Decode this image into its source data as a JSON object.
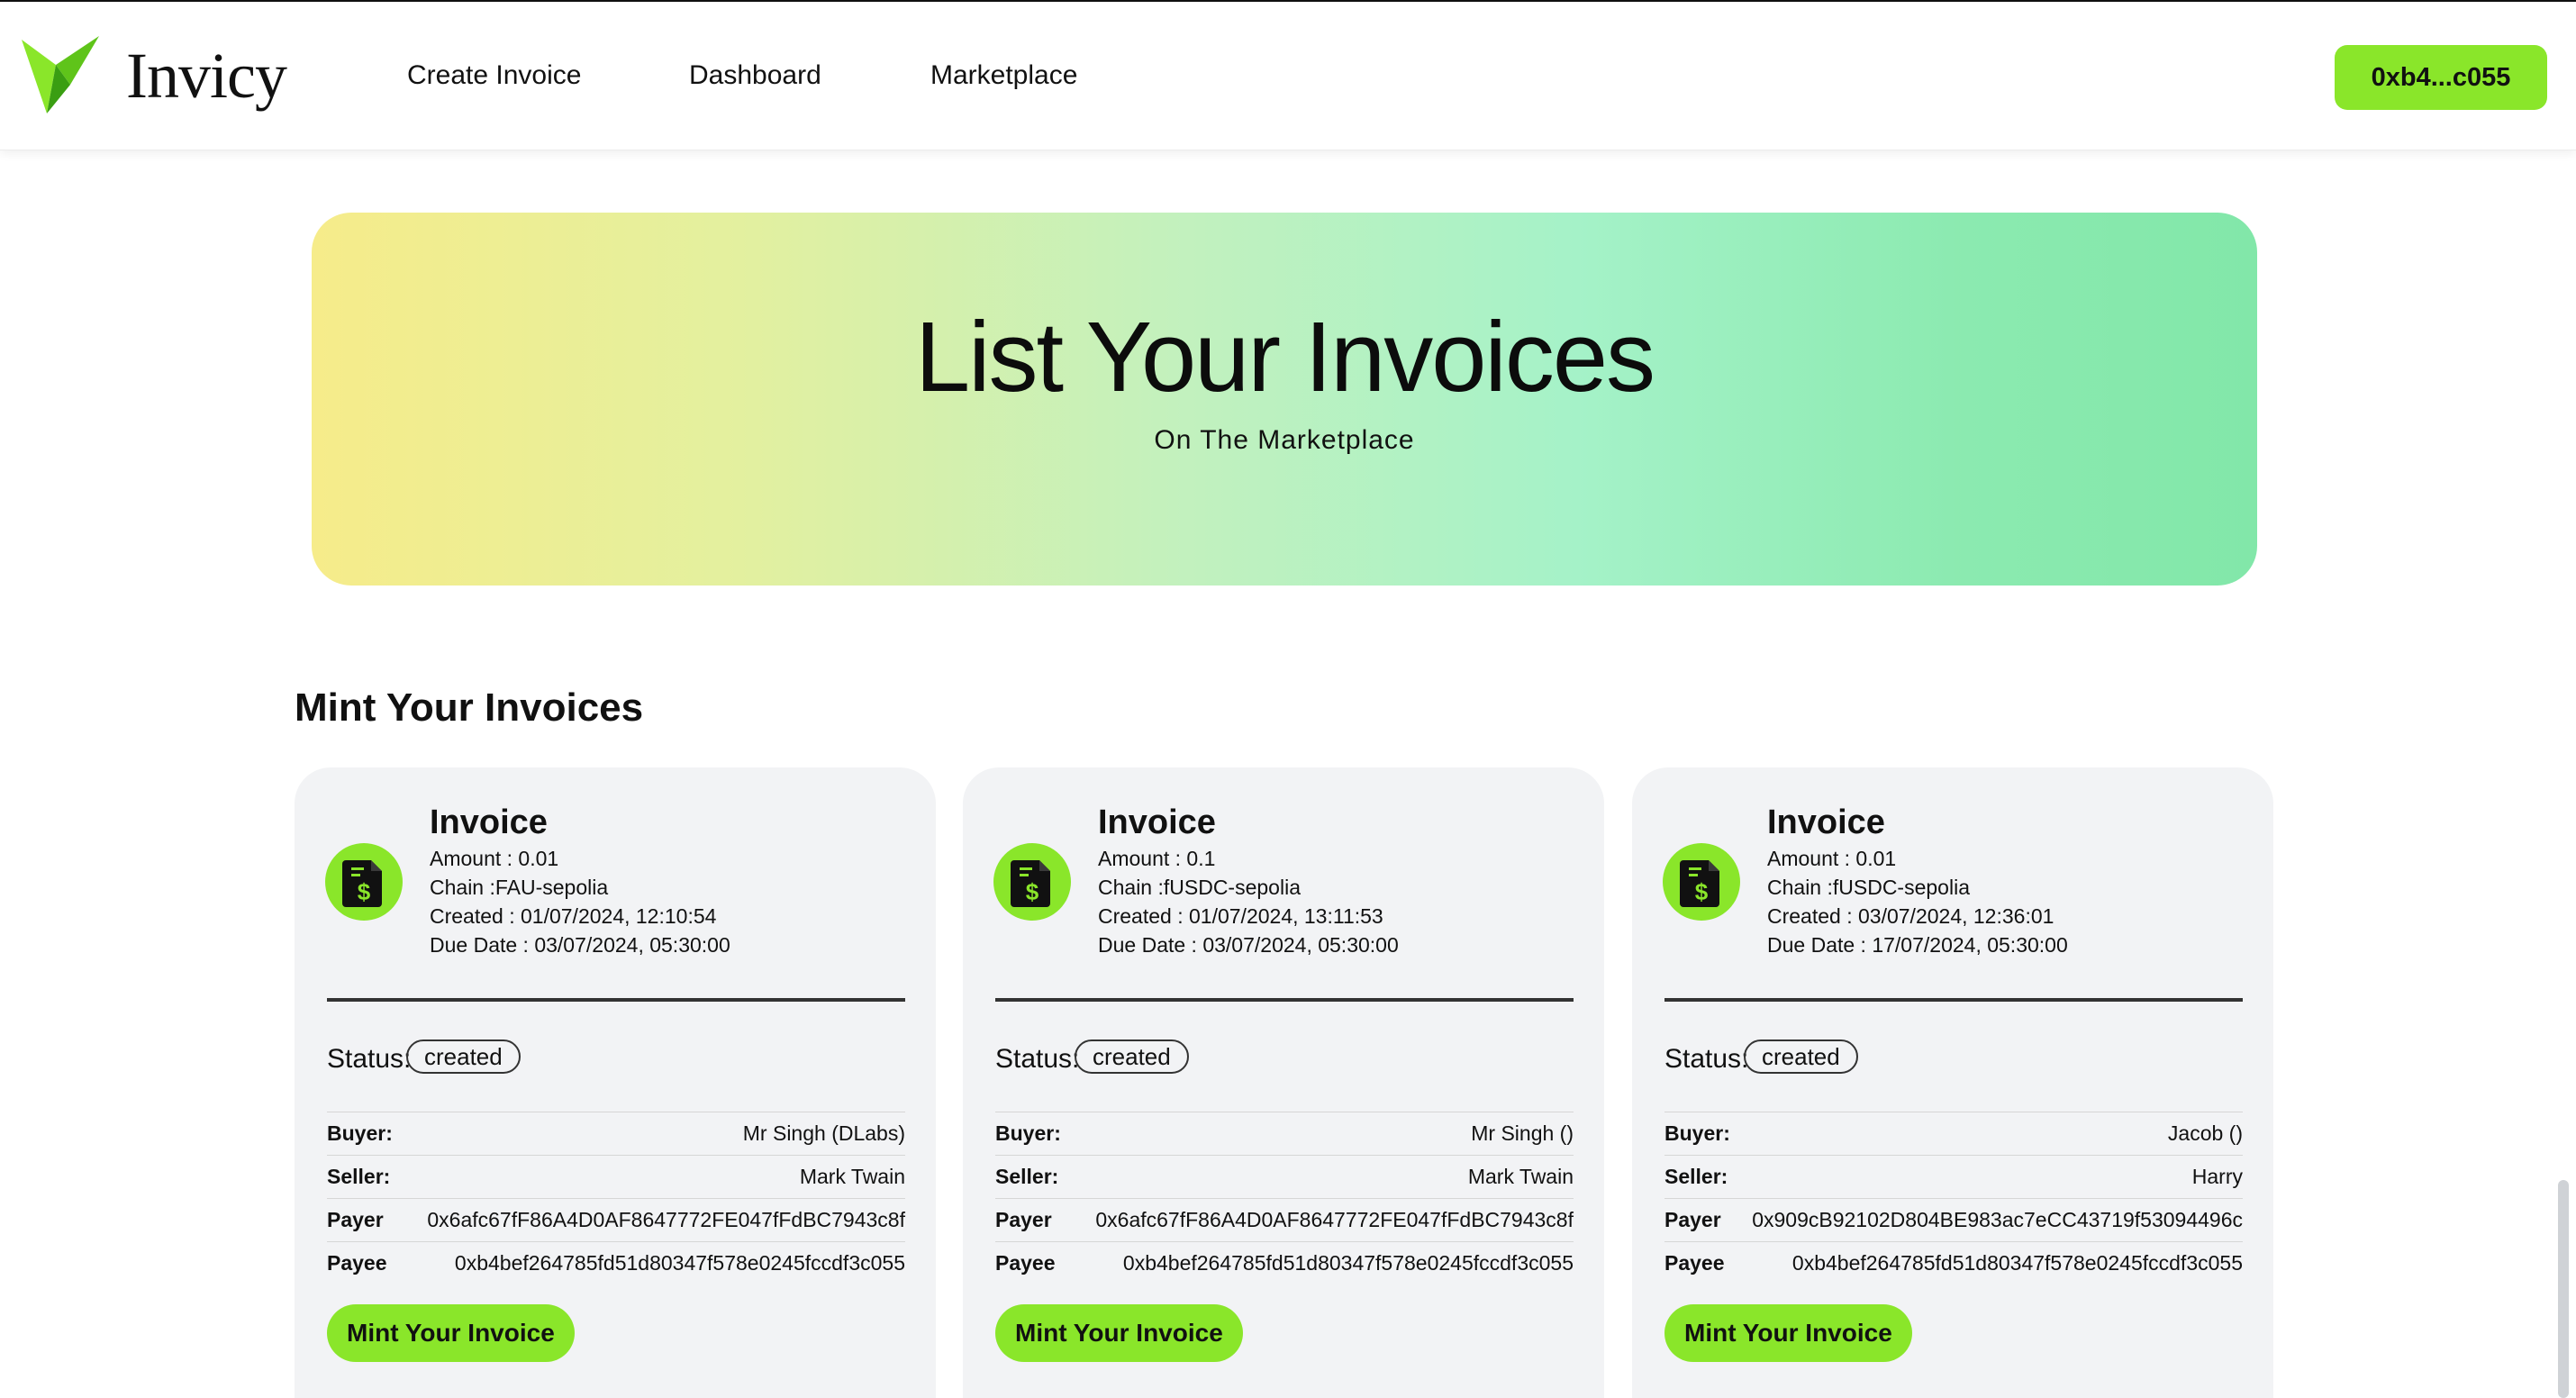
{
  "header": {
    "brand": "Invicy",
    "nav": [
      "Create Invoice",
      "Dashboard",
      "Marketplace"
    ],
    "wallet": "0xb4...c055"
  },
  "hero": {
    "title": "List Your Invoices",
    "subtitle": "On The Marketplace"
  },
  "section": {
    "title": "Mint Your Invoices"
  },
  "colors": {
    "accent": "#8ae62a",
    "text": "#111111",
    "card_bg": "#f2f3f5"
  },
  "cards": [
    {
      "title": "Invoice",
      "icon": "invoice-dollar-icon",
      "amount": "Amount : 0.01",
      "chain": "Chain :FAU-sepolia",
      "created": "Created : 01/07/2024, 12:10:54",
      "due": "Due Date : 03/07/2024, 05:30:00",
      "status_label": "Status:",
      "status": "created",
      "buyer_key": "Buyer:",
      "buyer": "Mr Singh (DLabs)",
      "seller_key": "Seller:",
      "seller": "Mark Twain",
      "payer_key": "Payer",
      "payer": "0x6afc67fF86A4D0AF8647772FE047fFdBC7943c8f",
      "payee_key": "Payee",
      "payee": "0xb4bef264785fd51d80347f578e0245fccdf3c055",
      "button": "Mint Your Invoice"
    },
    {
      "title": "Invoice",
      "icon": "invoice-dollar-icon",
      "amount": "Amount : 0.1",
      "chain": "Chain :fUSDC-sepolia",
      "created": "Created : 01/07/2024, 13:11:53",
      "due": "Due Date : 03/07/2024, 05:30:00",
      "status_label": "Status:",
      "status": "created",
      "buyer_key": "Buyer:",
      "buyer": "Mr Singh ()",
      "seller_key": "Seller:",
      "seller": "Mark Twain",
      "payer_key": "Payer",
      "payer": "0x6afc67fF86A4D0AF8647772FE047fFdBC7943c8f",
      "payee_key": "Payee",
      "payee": "0xb4bef264785fd51d80347f578e0245fccdf3c055",
      "button": "Mint Your Invoice"
    },
    {
      "title": "Invoice",
      "icon": "invoice-dollar-icon",
      "amount": "Amount : 0.01",
      "chain": "Chain :fUSDC-sepolia",
      "created": "Created : 03/07/2024, 12:36:01",
      "due": "Due Date : 17/07/2024, 05:30:00",
      "status_label": "Status:",
      "status": "created",
      "buyer_key": "Buyer:",
      "buyer": "Jacob ()",
      "seller_key": "Seller:",
      "seller": "Harry",
      "payer_key": "Payer",
      "payer": "0x909cB92102D804BE983ac7eCC43719f53094496c",
      "payee_key": "Payee",
      "payee": "0xb4bef264785fd51d80347f578e0245fccdf3c055",
      "button": "Mint Your Invoice"
    }
  ]
}
